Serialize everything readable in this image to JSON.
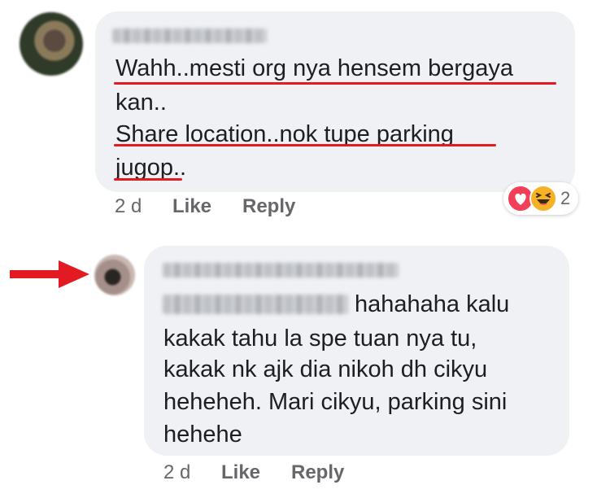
{
  "comment": {
    "lines": [
      "Wahh..mesti org nya hensem bergaya",
      "kan..",
      "Share location..nok tupe parking",
      "jugop.."
    ],
    "time": "2 d",
    "like_label": "Like",
    "reply_label": "Reply",
    "reaction_count": "2",
    "reaction_icons": [
      "love-icon",
      "haha-icon"
    ]
  },
  "reply": {
    "lines": [
      "hahahaha kalu",
      "kakak tahu la spe tuan nya tu,",
      "kakak nk ajk dia nikoh dh cikyu",
      "heheheh. Mari cikyu, parking sini",
      "hehehe"
    ],
    "time": "2 d",
    "like_label": "Like",
    "reply_label": "Reply"
  },
  "colors": {
    "bubble": "#eff1f4",
    "underline": "#e21a22",
    "arrow": "#e21a22",
    "love": "#f33e58",
    "haha": "#f7b125",
    "meta_text": "#65676b"
  }
}
